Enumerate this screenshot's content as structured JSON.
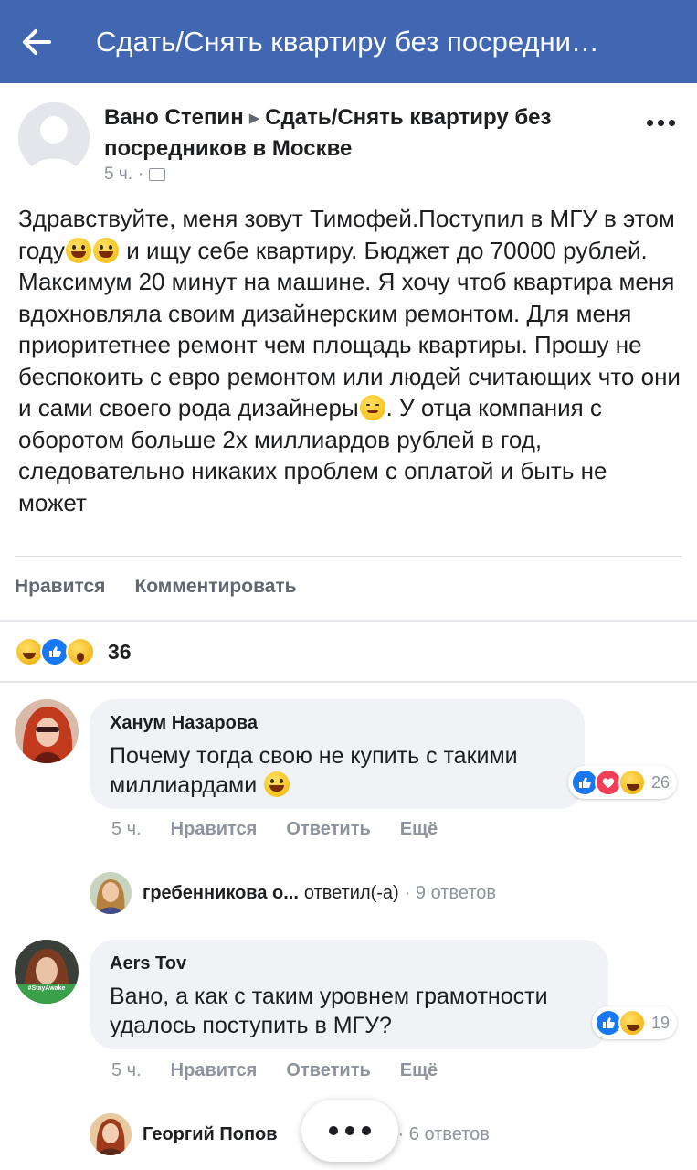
{
  "topbar": {
    "title": "Сдать/Снять квартиру без посредни…",
    "background": "#4267b2"
  },
  "post": {
    "author": "Вано Степин",
    "group": "Сдать/Снять квартиру без посредников в Москве",
    "time": "5 ч.",
    "body": {
      "p1": "Здравствуйте, меня зовут Тимофей.Поступил в МГУ в этом году",
      "p2": " и ищу себе квартиру. Бюджет до 70000 рублей. Максимум 20 минут на машине. Я хочу чтоб квартира меня вдохновляла своим дизайнерским ремонтом. Для меня приоритетнее ремонт чем площадь квартиры. Прошу не беспокоить с евро ремонтом или людей считающих что они и сами своего рода дизайнеры",
      "p3": ". У отца компания с оборотом больше 2х миллиардов рублей в год, следовательно никаких проблем с оплатой и быть не может"
    },
    "actions": {
      "like": "Нравится",
      "comment": "Комментировать"
    },
    "reactions": {
      "icons": [
        "haha-icon",
        "like-icon",
        "wow-icon"
      ],
      "count": "36"
    }
  },
  "comments": [
    {
      "author": "Ханум Назарова",
      "text": "Почему тогда свою не купить с такими миллиардами",
      "reactions": {
        "icons": [
          "like-icon",
          "love-icon",
          "haha-icon"
        ],
        "count": "26"
      },
      "time": "5 ч.",
      "like": "Нравится",
      "reply": "Ответить",
      "more": "Ещё",
      "replies_preview": {
        "name": "гребенникова о...",
        "action": "ответил(-а)",
        "count": "· 9 ответов"
      }
    },
    {
      "author": "Aers Tov",
      "avatar_badge": "#StayAwake",
      "text": "Вано, а как с таким уровнем грамотности удалось поступить в МГУ?",
      "reactions": {
        "icons": [
          "like-icon",
          "haha-icon"
        ],
        "count": "19"
      },
      "time": "5 ч.",
      "like": "Нравится",
      "reply": "Ответить",
      "more": "Ещё",
      "replies_preview": {
        "name": "Георгий Попов",
        "action": "",
        "count": "· 6 ответов"
      }
    }
  ],
  "colors": {
    "accent": "#4267b2",
    "like_blue": "#1877f2",
    "love_red": "#f33e58",
    "bubble_bg": "#f0f2f5",
    "muted_text": "#8d949e"
  }
}
